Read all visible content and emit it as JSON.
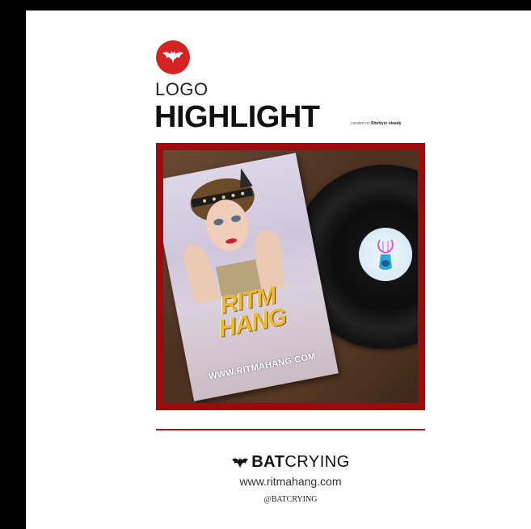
{
  "header": {
    "logo_icon": "bat-logo-icon",
    "logo_color": "#d42323",
    "logo_label": "LOGO",
    "title": "HIGHLIGHT",
    "caption_prefix": "curated on",
    "caption_name": "Shefryer steady"
  },
  "cover": {
    "title_line1": "RITM",
    "title_line2": "HANG",
    "url": "WWW.RITMAHANG.COM"
  },
  "footer": {
    "brand_icon": "bat-wings-icon",
    "brand_bold": "BAT",
    "brand_light": "CRYING",
    "website": "www.ritmahang.com",
    "handle": "@BATCRYING",
    "accent_color": "#a11b1b"
  }
}
